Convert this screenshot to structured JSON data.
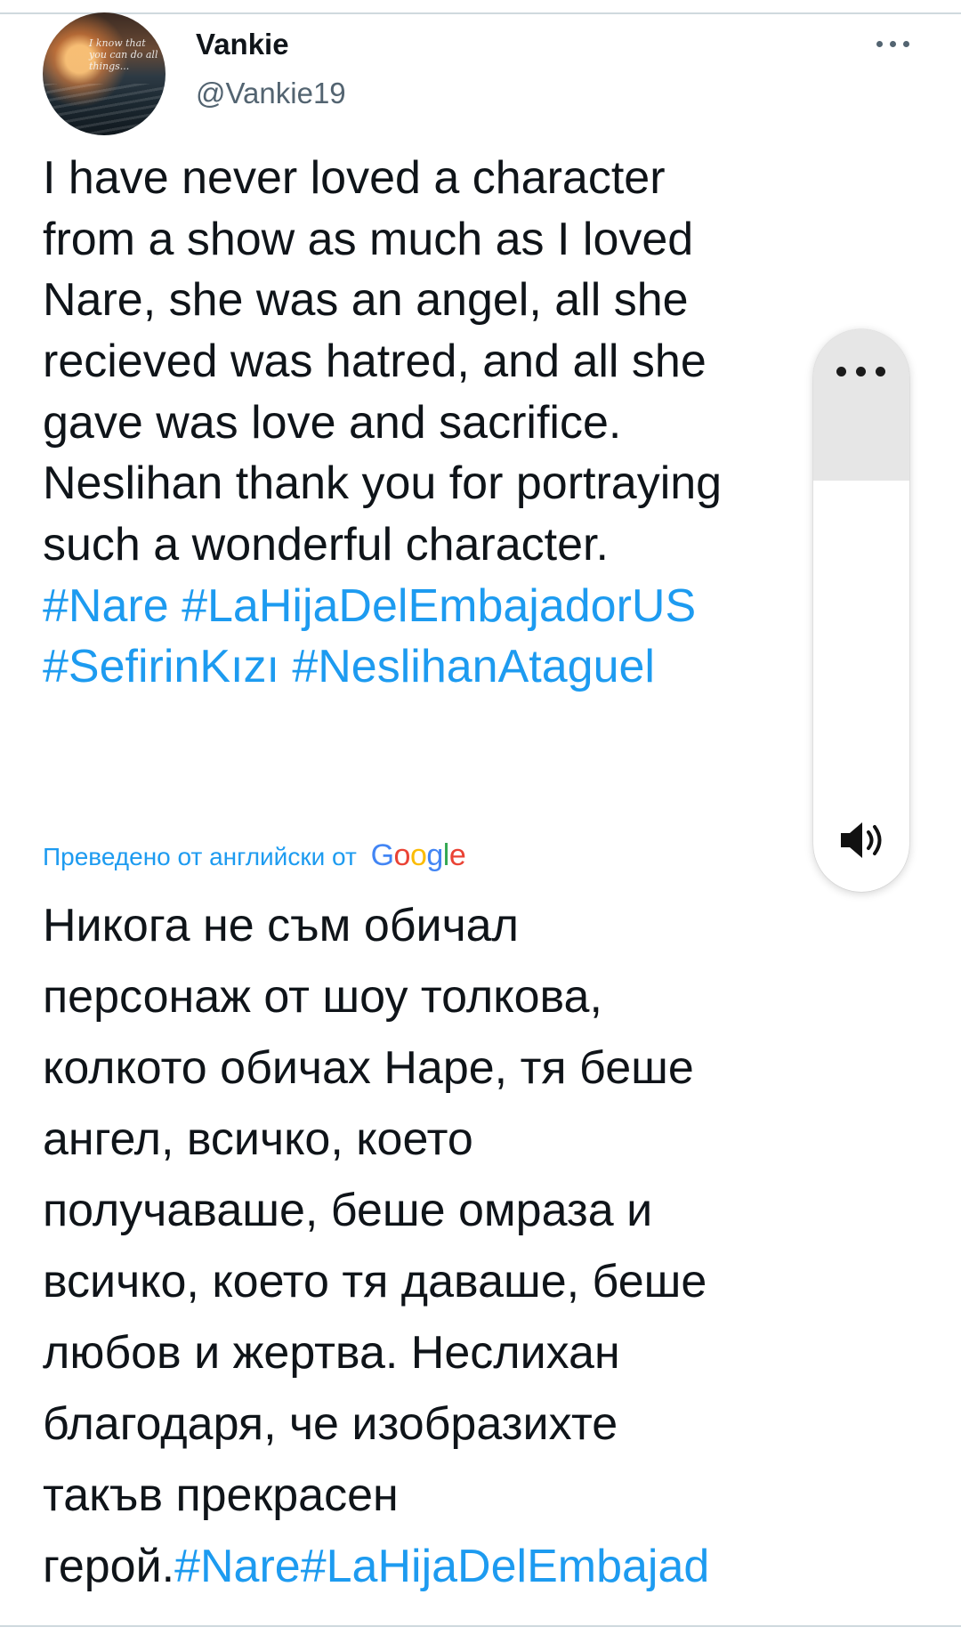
{
  "author": {
    "display_name": "Vankie",
    "handle": "@Vankie19",
    "avatar_icon": "sunset-sea-quote-avatar",
    "avatar_text": "I know that you can do all things..."
  },
  "tweet": {
    "lines": [
      "I have never loved a character",
      "from a show as much as I loved",
      "Nare, she was an angel, all she",
      "recieved was hatred, and all she",
      "gave was love and sacrifice.",
      "Neslihan thank you for portraying",
      "such a wonderful character."
    ],
    "hashtag_lines": [
      "#Nare #LaHijaDelEmbajadorUS",
      "#SefirinKızı #NeslihanAtaguel"
    ]
  },
  "translation": {
    "label": "Преведено от английски от",
    "provider": "Google",
    "provider_colors": [
      "#4285F4",
      "#EA4335",
      "#FBBC05",
      "#4285F4",
      "#34A853",
      "#EA4335"
    ],
    "lines": [
      "Никога не съм обичал",
      "персонаж от шоу толкова,",
      "колкото обичах Наре, тя беше",
      "ангел, всичко, което",
      "получаваше, беше омраза и",
      "всичко, което тя даваше, беше",
      "любов и жертва. Неслихан",
      "благодаря, че изобразихте",
      "такъв прекрасен"
    ],
    "last_line_prefix": "герой.",
    "last_line_hashtags": "#Nare#LaHijaDelEmbajad"
  },
  "colors": {
    "accent": "#1d9bf0",
    "secondary_text": "#536471",
    "divider": "#cfd9de"
  },
  "floating_panel": {
    "menu_icon": "more-dots-icon",
    "speaker_icon": "speaker-icon"
  }
}
